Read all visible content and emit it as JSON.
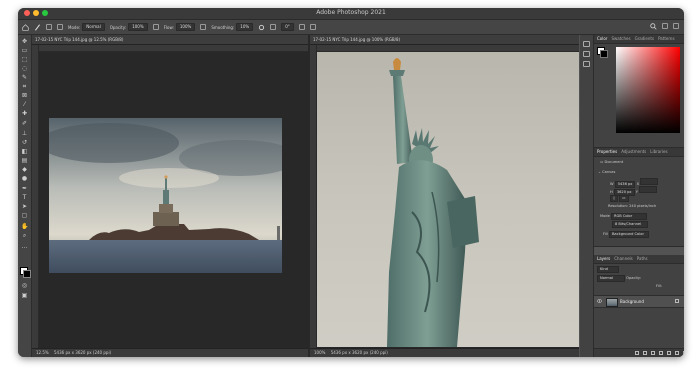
{
  "app": {
    "window_title": "Adobe Photoshop 2021"
  },
  "options_bar": {
    "mode_label": "Mode:",
    "mode_value": "Normal",
    "opacity_label": "Opacity:",
    "opacity_value": "100%",
    "flow_label": "Flow:",
    "flow_value": "100%",
    "smoothing_label": "Smoothing:",
    "smoothing_value": "10%",
    "angle_value": "0°"
  },
  "documents": [
    {
      "tab": "17-02-15 NYC Trip 144.jpg @ 12.5% (RGB/8)",
      "zoom": "12.5%",
      "info": "5436 px x 3620 px (240 ppi)"
    },
    {
      "tab": "17-02-15 NYC Trip 144.jpg @ 100% (RGB/8)",
      "zoom": "100%",
      "info": "5436 px x 3620 px (240 ppi)"
    }
  ],
  "color_panel": {
    "tabs": [
      "Color",
      "Swatches",
      "Gradients",
      "Patterns"
    ],
    "colors": {
      "foreground": "#ffffff",
      "background": "#000000",
      "hue": "#ff0000"
    }
  },
  "properties_panel": {
    "tabs": [
      "Properties",
      "Adjustments",
      "Libraries"
    ],
    "type_label": "Document",
    "canvas_label": "Canvas",
    "w_label": "W",
    "w_value": "5436 px",
    "h_label": "H",
    "h_value": "3620 px",
    "x_label": "X",
    "y_label": "Y",
    "resolution": "Resolution: 240 pixels/inch",
    "mode_label": "Mode",
    "mode_value": "RGB Color",
    "bits_value": "8 Bits/Channel",
    "fill_label": "Fill",
    "fill_value": "Background Color"
  },
  "layers_panel": {
    "tabs": [
      "Layers",
      "Channels",
      "Paths"
    ],
    "kind_label": "Kind",
    "blend_label": "Normal",
    "opacity_label": "Opacity:",
    "fill_label": "Fill:",
    "layer_name": "Background"
  },
  "icons": [
    "brush-icon",
    "move-tool-icon",
    "marquee-tool-icon",
    "lasso-tool-icon",
    "crop-tool-icon",
    "eyedropper-tool-icon",
    "healing-tool-icon",
    "eraser-tool-icon",
    "gradient-tool-icon",
    "pen-tool-icon",
    "type-tool-icon",
    "hand-tool-icon",
    "zoom-tool-icon",
    "eye-icon",
    "lock-icon",
    "gear-icon",
    "search-icon"
  ]
}
